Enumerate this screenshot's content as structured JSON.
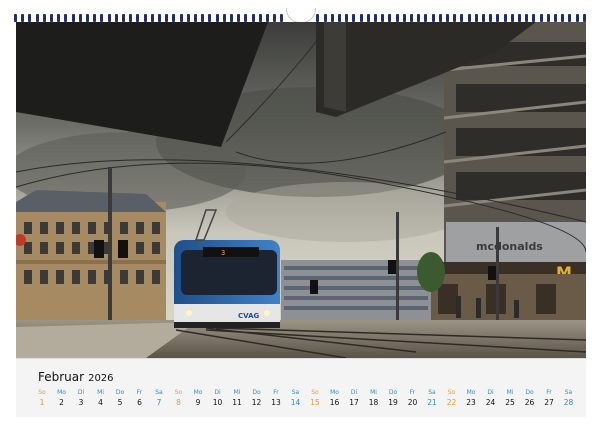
{
  "calendar": {
    "month": "Februar",
    "year": "2026",
    "days": [
      {
        "wd": "So",
        "num": "1",
        "type": "sun"
      },
      {
        "wd": "Mo",
        "num": "2",
        "type": "wk"
      },
      {
        "wd": "Di",
        "num": "3",
        "type": "wk"
      },
      {
        "wd": "Mi",
        "num": "4",
        "type": "wk"
      },
      {
        "wd": "Do",
        "num": "5",
        "type": "wk"
      },
      {
        "wd": "Fr",
        "num": "6",
        "type": "wk"
      },
      {
        "wd": "Sa",
        "num": "7",
        "type": "sat"
      },
      {
        "wd": "So",
        "num": "8",
        "type": "sun"
      },
      {
        "wd": "Mo",
        "num": "9",
        "type": "wk"
      },
      {
        "wd": "Di",
        "num": "10",
        "type": "wk"
      },
      {
        "wd": "Mi",
        "num": "11",
        "type": "wk"
      },
      {
        "wd": "Do",
        "num": "12",
        "type": "wk"
      },
      {
        "wd": "Fr",
        "num": "13",
        "type": "wk"
      },
      {
        "wd": "Sa",
        "num": "14",
        "type": "sat"
      },
      {
        "wd": "So",
        "num": "15",
        "type": "sun"
      },
      {
        "wd": "Mo",
        "num": "16",
        "type": "wk"
      },
      {
        "wd": "Di",
        "num": "17",
        "type": "wk"
      },
      {
        "wd": "Mi",
        "num": "18",
        "type": "wk"
      },
      {
        "wd": "Do",
        "num": "19",
        "type": "wk"
      },
      {
        "wd": "Fr",
        "num": "20",
        "type": "wk"
      },
      {
        "wd": "Sa",
        "num": "21",
        "type": "sat"
      },
      {
        "wd": "So",
        "num": "22",
        "type": "sun"
      },
      {
        "wd": "Mo",
        "num": "23",
        "type": "wk"
      },
      {
        "wd": "Di",
        "num": "24",
        "type": "wk"
      },
      {
        "wd": "Mi",
        "num": "25",
        "type": "wk"
      },
      {
        "wd": "Do",
        "num": "26",
        "type": "wk"
      },
      {
        "wd": "Fr",
        "num": "27",
        "type": "wk"
      },
      {
        "wd": "Sa",
        "num": "28",
        "type": "sat"
      }
    ]
  },
  "photo": {
    "tram_sign": "CVAG",
    "store_sign": "mcdonalds",
    "destination_display": "3"
  },
  "colors": {
    "binding": "#1f2f6a",
    "weekday_label": "#2a8ec4",
    "sunday": "#e29a2a",
    "tram_body": "#2f6fb5"
  }
}
